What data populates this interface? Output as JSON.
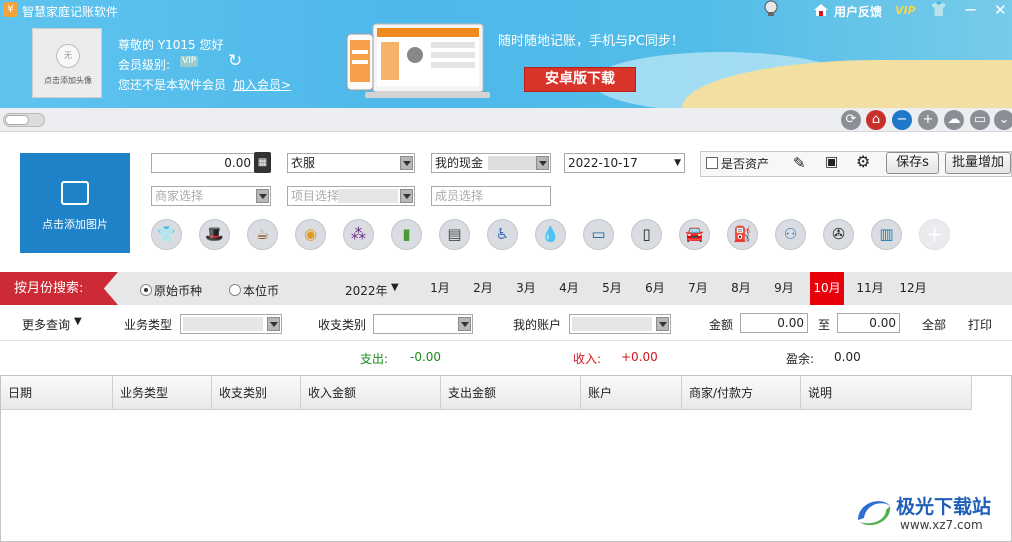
{
  "window": {
    "title": "智慧家庭记账软件",
    "feedback_label": "用户反馈",
    "vip_label": "VIP",
    "minimize": "−",
    "close": "✕"
  },
  "user": {
    "avatar_placeholder": "无",
    "avatar_caption": "点击添加头像",
    "greeting": "尊敬的 Y1015 您好",
    "level_label": "会员级别:",
    "level_badge": "VIP",
    "not_member_text": "您还不是本软件会员",
    "join_link": "加入会员>"
  },
  "banner": {
    "slogan": "随时随地记账，手机与PC同步！",
    "android_button": "安卓版下载"
  },
  "form": {
    "photo_label": "点击添加图片",
    "amount": "0.00",
    "category": "衣服",
    "account": "我的现金",
    "date": "2022-10-17",
    "is_asset_label": "是否资产",
    "save_label": "保存s",
    "batch_add_label": "批量增加",
    "merchant_placeholder": "商家选择",
    "project_placeholder": "项目选择",
    "member_placeholder": "成员选择"
  },
  "category_icons": [
    "shirt-icon",
    "hat-icon",
    "coffee-icon",
    "pizza-icon",
    "grapes-icon",
    "drink-icon",
    "receipt-icon",
    "stroller-icon",
    "water-drop-icon",
    "phone-card-icon",
    "mobile-phone-icon",
    "car-icon",
    "fuel-nozzle-icon",
    "family-icon",
    "film-reel-icon",
    "book-icon",
    "add-category-icon"
  ],
  "filter": {
    "month_search_label": "按月份搜索:",
    "original_currency": "原始币种",
    "base_currency": "本位币",
    "year": "2022年",
    "months": [
      "1月",
      "2月",
      "3月",
      "4月",
      "5月",
      "6月",
      "7月",
      "8月",
      "9月",
      "10月",
      "11月",
      "12月"
    ],
    "active_month": "10月"
  },
  "query": {
    "more_query": "更多查询",
    "business_type_label": "业务类型",
    "income_expense_type_label": "收支类别",
    "my_account_label": "我的账户",
    "amount_label": "金额",
    "amount_from": "0.00",
    "to_label": "至",
    "amount_to": "0.00",
    "all_label": "全部",
    "print_label": "打印"
  },
  "summary": {
    "expense_label": "支出:",
    "expense_value": "-0.00",
    "income_label": "收入:",
    "income_value": "+0.00",
    "balance_label": "盈余:",
    "balance_value": "0.00",
    "expense_color": "#1a8c1a",
    "income_color": "#d3161e"
  },
  "table": {
    "columns": [
      "日期",
      "业务类型",
      "收支类别",
      "收入金额",
      "支出金额",
      "账户",
      "商家/付款方",
      "说明"
    ],
    "rows": []
  },
  "watermark": {
    "text": "极光下载站",
    "url": "www.xz7.com"
  }
}
